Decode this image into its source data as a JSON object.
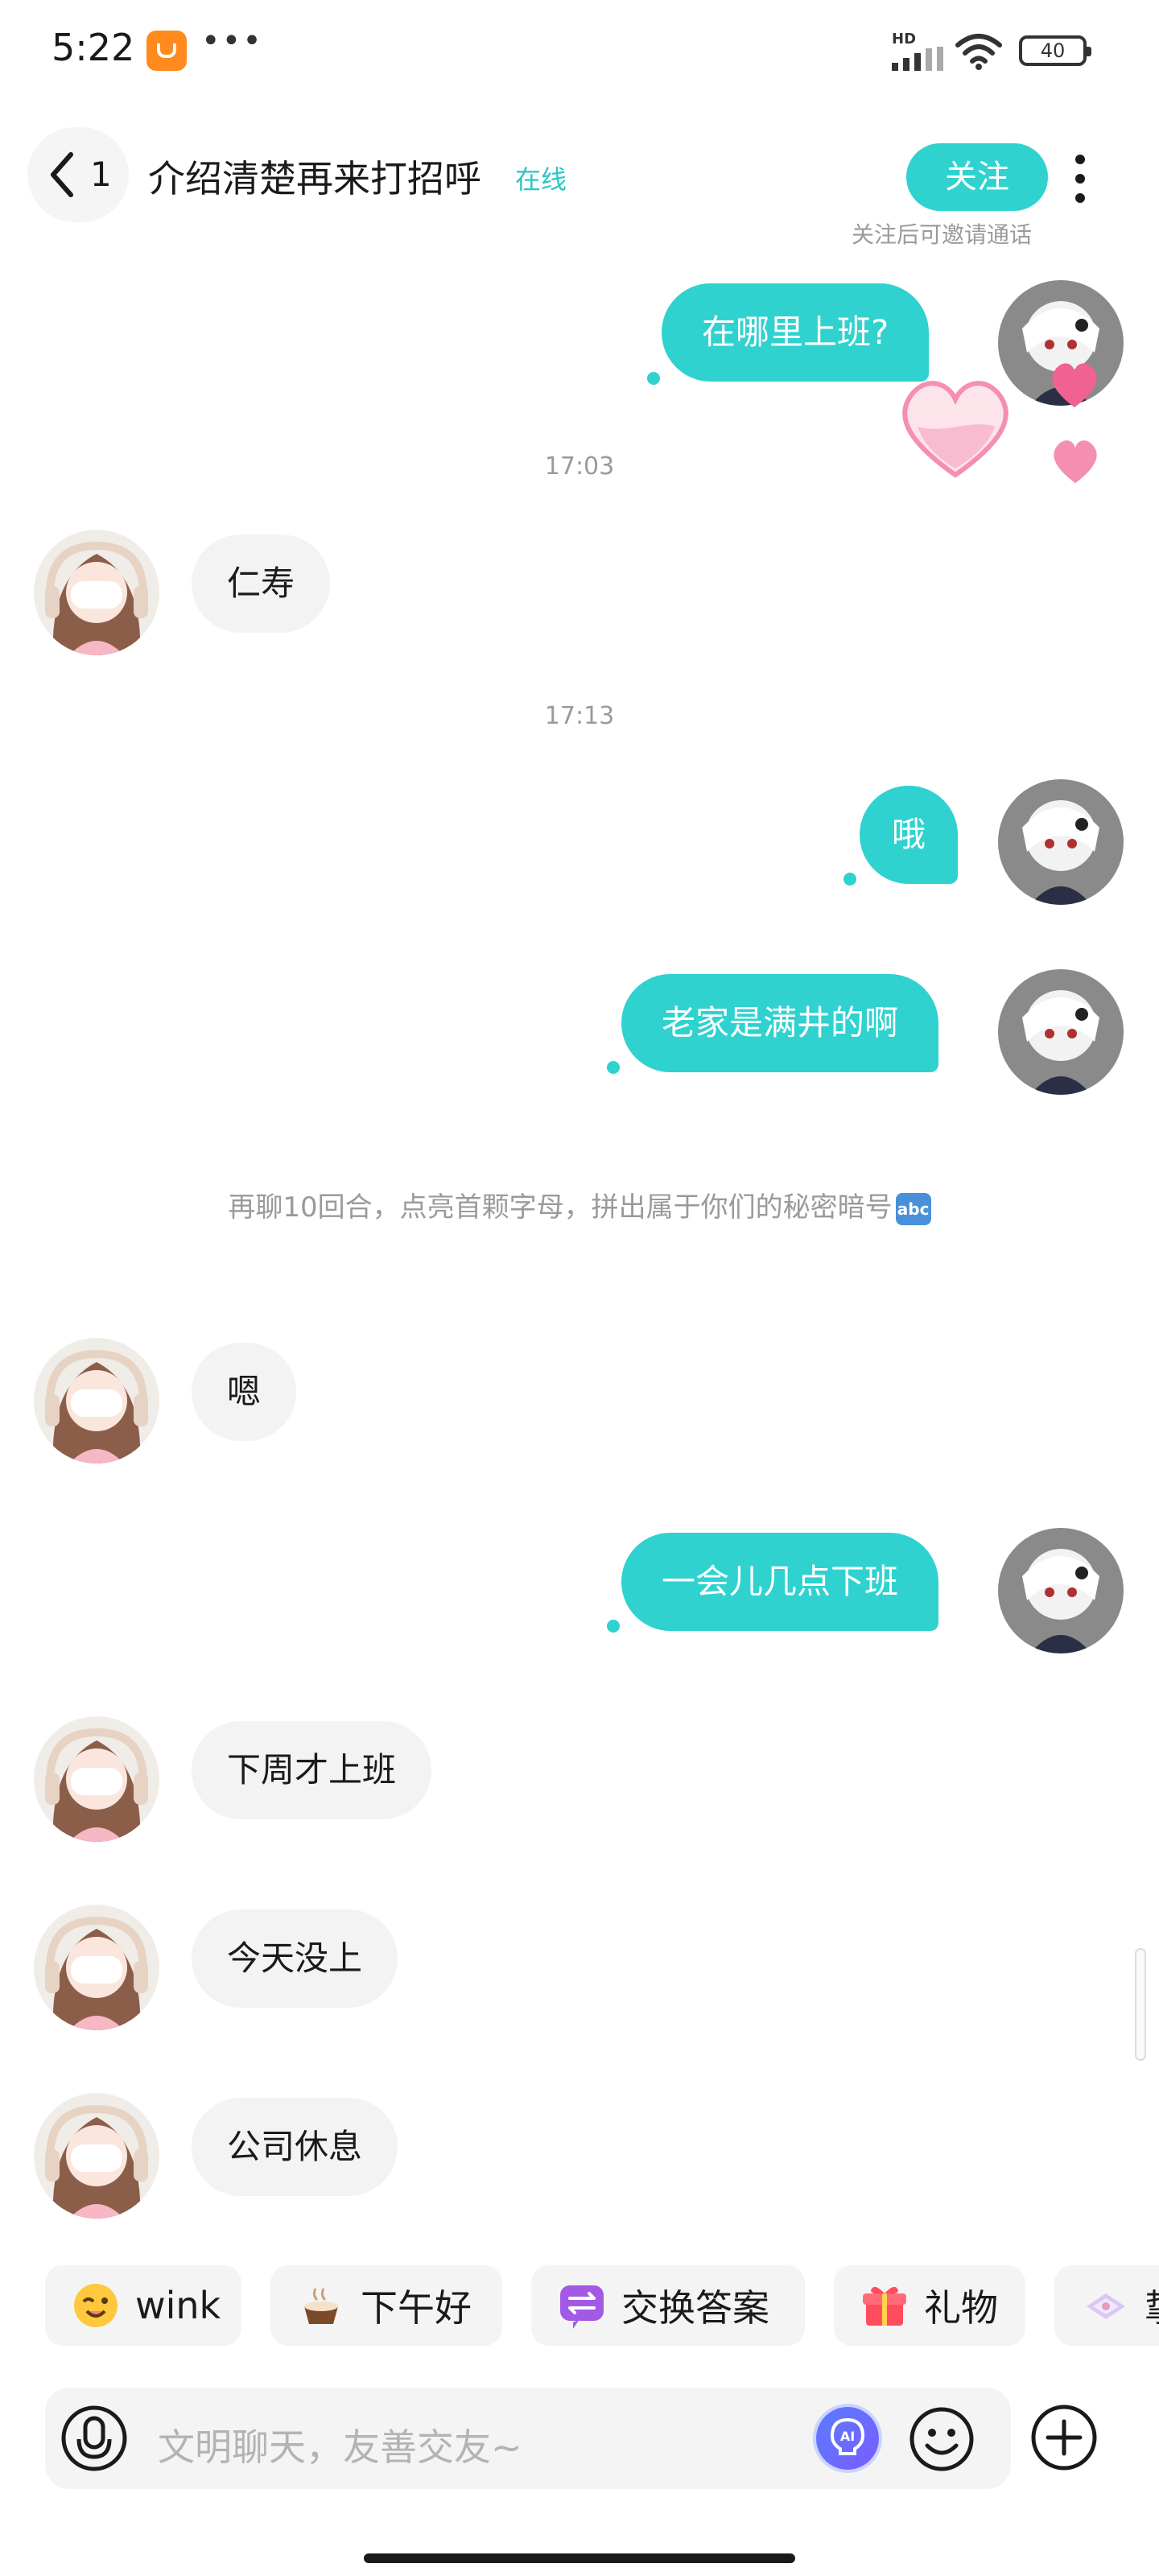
{
  "status_bar": {
    "time": "5:22",
    "more": "•••",
    "network": "HD",
    "battery": "40"
  },
  "header": {
    "back_count": "1",
    "title": "介绍清楚再来打招呼",
    "online_status": "在线",
    "follow_label": "关注",
    "follow_hint": "关注后可邀请通话"
  },
  "messages": [
    {
      "side": "out",
      "text": "在哪里上班?"
    },
    {
      "type": "time",
      "text": "17:03"
    },
    {
      "side": "in",
      "text": "仁寿"
    },
    {
      "type": "time",
      "text": "17:13"
    },
    {
      "side": "out",
      "text": "哦"
    },
    {
      "side": "out",
      "text": "老家是满井的啊"
    },
    {
      "type": "system",
      "text": "再聊10回合，点亮首颗字母，拼出属于你们的秘密暗号",
      "badge": "abc"
    },
    {
      "side": "in",
      "text": "嗯"
    },
    {
      "side": "out",
      "text": "一会儿几点下班"
    },
    {
      "side": "in",
      "text": "下周才上班"
    },
    {
      "side": "in",
      "text": "今天没上"
    },
    {
      "side": "in",
      "text": "公司休息"
    }
  ],
  "quick_actions": [
    {
      "label": "wink",
      "icon": "wink-emoji-icon"
    },
    {
      "label": "下午好",
      "icon": "coffee-icon"
    },
    {
      "label": "交换答案",
      "icon": "exchange-icon"
    },
    {
      "label": "礼物",
      "icon": "gift-icon"
    },
    {
      "label": "挚",
      "icon": "card-icon"
    }
  ],
  "input": {
    "placeholder": "文明聊天，友善交友~",
    "ai_label": "AI"
  },
  "colors": {
    "accent": "#2fd2cf",
    "bubble_in": "#f3f3f3",
    "muted_text": "#9a9a9a"
  }
}
